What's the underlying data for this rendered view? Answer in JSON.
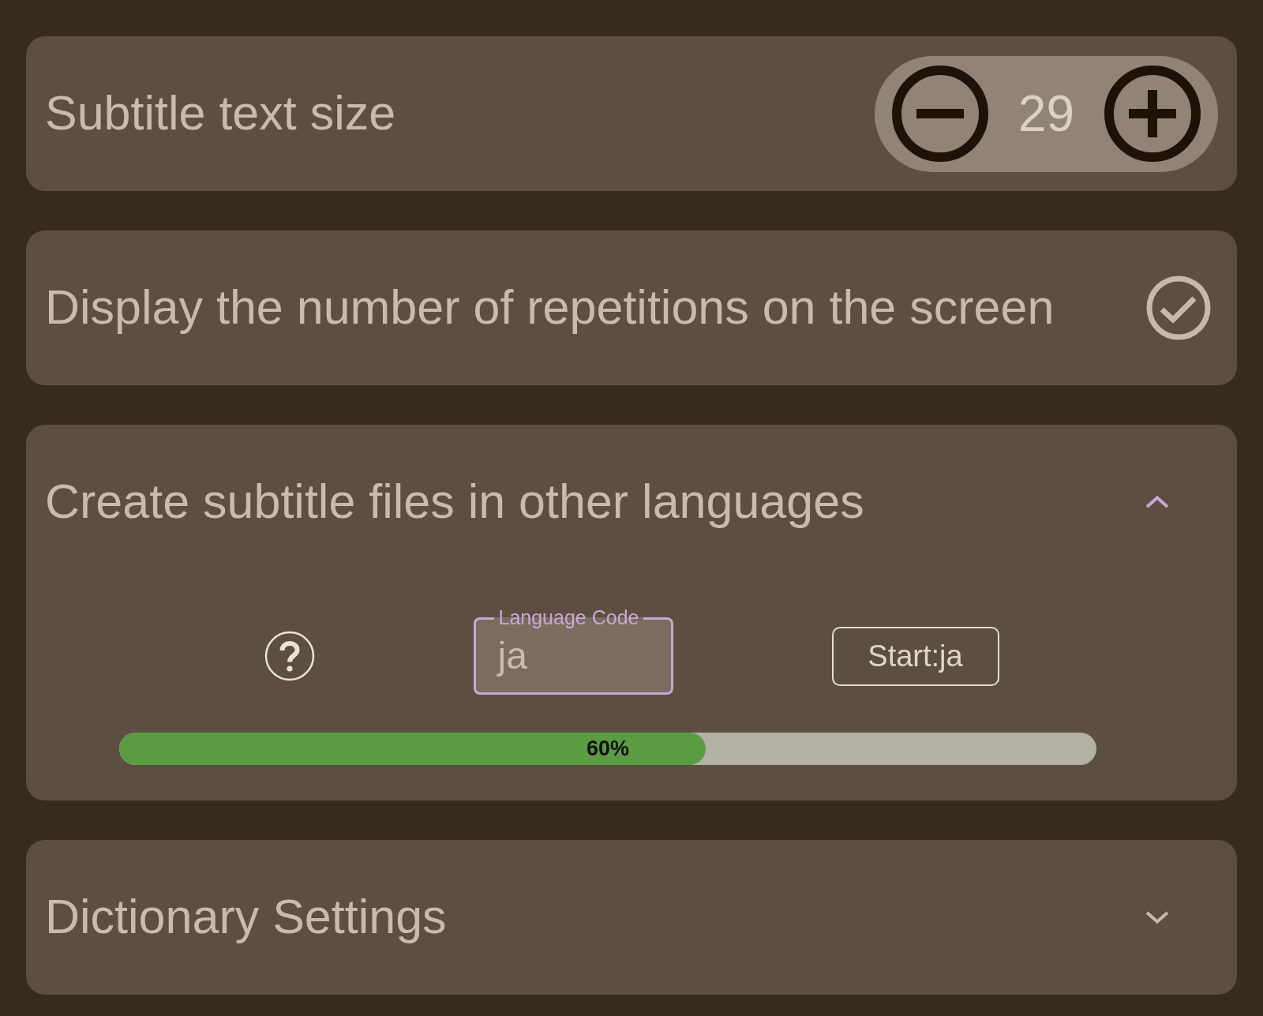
{
  "settings": [
    {
      "kind": "stepper",
      "label": "Subtitle text size",
      "value": "29"
    },
    {
      "kind": "checkbox",
      "label": "Display the number of repetitions on the screen",
      "checked": true
    },
    {
      "kind": "expandable",
      "label": "Create subtitle files in other languages",
      "expanded": true,
      "content": {
        "language_field": {
          "label": "Language Code",
          "value": "ja"
        },
        "start_button": "Start:ja",
        "progress": {
          "level": 0.6,
          "reading": "60%"
        }
      }
    },
    {
      "kind": "expandable",
      "label": "Dictionary Settings",
      "expanded": false
    }
  ]
}
